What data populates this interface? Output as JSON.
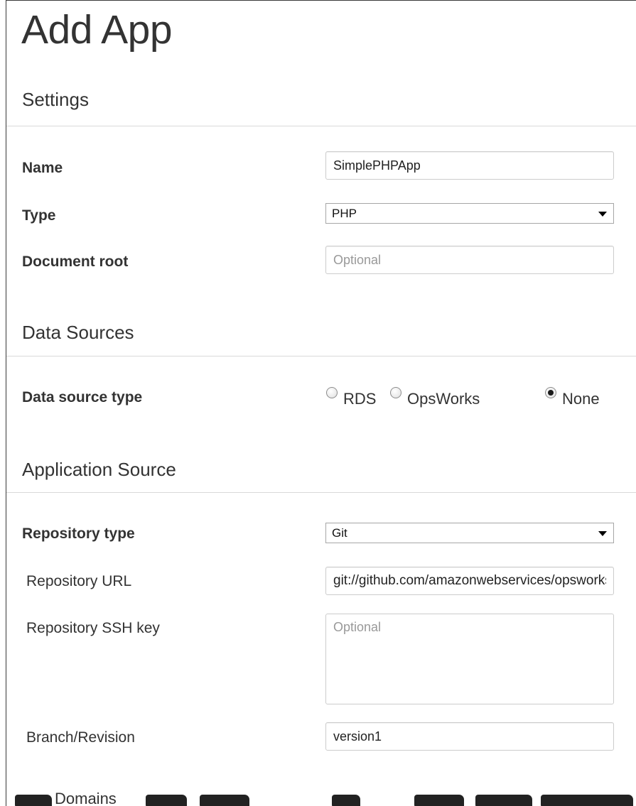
{
  "page": {
    "title": "Add App"
  },
  "settings": {
    "section_title": "Settings",
    "name": {
      "label": "Name",
      "value": "SimplePHPApp"
    },
    "type": {
      "label": "Type",
      "value": "PHP"
    },
    "document_root": {
      "label": "Document root",
      "placeholder": "Optional"
    }
  },
  "data_sources": {
    "section_title": "Data Sources",
    "type_label": "Data source type",
    "options": [
      {
        "label": "RDS",
        "checked": false
      },
      {
        "label": "OpsWorks",
        "checked": false
      },
      {
        "label": "None",
        "checked": true
      }
    ]
  },
  "application_source": {
    "section_title": "Application Source",
    "repository_type": {
      "label": "Repository type",
      "value": "Git"
    },
    "repository_url": {
      "label": "Repository URL",
      "value": "git://github.com/amazonwebservices/opsworks-demo-php-simple-app.git"
    },
    "ssh_key": {
      "label": "Repository SSH key",
      "placeholder": "Optional"
    },
    "branch": {
      "label": "Branch/Revision",
      "value": "version1"
    }
  },
  "next_section_partial": {
    "title": "Domains"
  }
}
